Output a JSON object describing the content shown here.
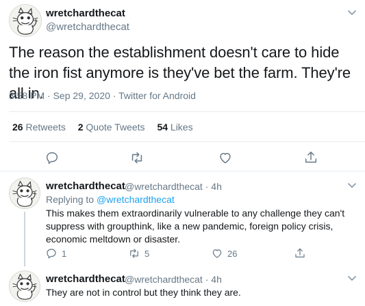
{
  "main_tweet": {
    "display_name": "wretchardthecat",
    "handle": "@wretchardthecat",
    "text": "The reason the establishment doesn't care to hide the iron fist anymore is they've bet the farm. They're all in.",
    "time": "3:58 PM",
    "date": "Sep 29, 2020",
    "source": "Twitter for Android",
    "retweets_count": "26",
    "retweets_label": "Retweets",
    "quotes_count": "2",
    "quotes_label": "Quote Tweets",
    "likes_count": "54",
    "likes_label": "Likes"
  },
  "replies": [
    {
      "display_name": "wretchardthecat",
      "handle": "@wretchardthecat",
      "age": "4h",
      "replying_prefix": "Replying to",
      "replying_to": "@wretchardthecat",
      "text_lines": [
        "This makes them extraordinarily vulnerable to any challenge they can't",
        "suppress with groupthink,  like a new pandemic,  foreign policy crisis,",
        "economic meltdown or disaster."
      ],
      "reply_count": "1",
      "retweet_count": "5",
      "like_count": "26"
    },
    {
      "display_name": "wretchardthecat",
      "handle": "@wretchardthecat",
      "age": "4h",
      "text": "They are not in control but they think they are."
    }
  ],
  "icons": {
    "reply": "reply-icon",
    "retweet": "retweet-icon",
    "like": "heart-icon",
    "share": "share-icon",
    "more": "chevron-down-icon"
  },
  "colors": {
    "text": "#14171a",
    "muted": "#657786",
    "link": "#1da1f2",
    "divider": "#e6ecf0"
  }
}
